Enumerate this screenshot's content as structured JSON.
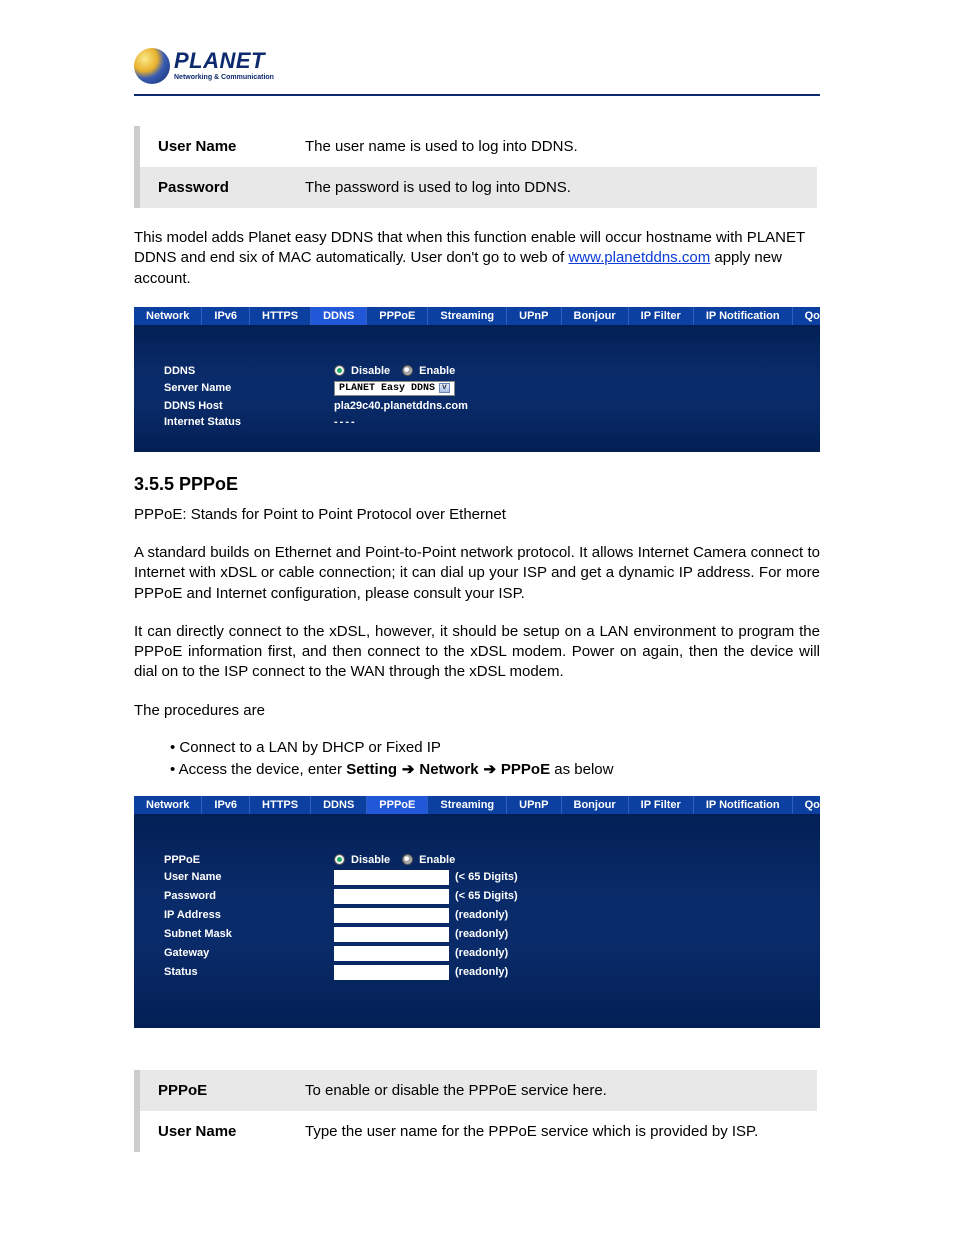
{
  "brand": {
    "name": "PLANET",
    "tagline": "Networking & Communication"
  },
  "def_table_top": [
    {
      "label": "User Name",
      "desc": "The user name is used to log into DDNS."
    },
    {
      "label": "Password",
      "desc": "The password is used to log into DDNS."
    }
  ],
  "intro_paragraph_pre": "This model adds Planet easy DDNS that when this function enable will occur hostname with PLANET DDNS and end six of MAC automatically. User don't go to web of ",
  "intro_link_text": "www.planetddns.com",
  "intro_paragraph_post": " apply new account.",
  "tabs": [
    "Network",
    "IPv6",
    "HTTPS",
    "DDNS",
    "PPPoE",
    "Streaming",
    "UPnP",
    "Bonjour",
    "IP Filter",
    "IP Notification",
    "QoS"
  ],
  "ddns_panel": {
    "active_tab": "DDNS",
    "rows": {
      "ddns_label": "DDNS",
      "disable": "Disable",
      "enable": "Enable",
      "server_name_label": "Server Name",
      "server_name_value": "PLANET Easy DDNS",
      "ddns_host_label": "DDNS Host",
      "ddns_host_value": "pla29c40.planetddns.com",
      "internet_status_label": "Internet Status",
      "internet_status_value": "----"
    }
  },
  "section_title": "3.5.5 PPPoE",
  "pppoe_def": "PPPoE: Stands for Point to Point Protocol over Ethernet",
  "pppoe_p1": "A standard builds on Ethernet and Point-to-Point network protocol. It allows Internet Camera connect to Internet with xDSL or cable connection; it can dial up your ISP and get a dynamic IP address. For more PPPoE and Internet configuration, please consult your ISP.",
  "pppoe_p2": "It can directly connect to the xDSL, however, it should be setup on a LAN environment to program the PPPoE information first, and then connect to the xDSL modem. Power on again, then the device will dial on to the ISP connect to the WAN through the xDSL modem.",
  "procedures_label": "The procedures are",
  "bullet1": "Connect to a LAN by DHCP or Fixed IP",
  "bullet2_pre": "Access the device, enter ",
  "bullet2_path": {
    "a": "Setting",
    "b": "Network",
    "c": "PPPoE"
  },
  "bullet2_post": " as below",
  "pppoe_panel": {
    "active_tab": "PPPoE",
    "labels": {
      "pppoe": "PPPoE",
      "disable": "Disable",
      "enable": "Enable",
      "user_name": "User Name",
      "password": "Password",
      "ip_address": "IP Address",
      "subnet_mask": "Subnet Mask",
      "gateway": "Gateway",
      "status": "Status"
    },
    "hints": {
      "digits": "(< 65 Digits)",
      "readonly": "(readonly)"
    }
  },
  "def_table_bottom": [
    {
      "label": "PPPoE",
      "desc": "To enable or disable the PPPoE service here."
    },
    {
      "label": "User Name",
      "desc": "Type the user name for the PPPoE service which is provided by ISP."
    }
  ]
}
